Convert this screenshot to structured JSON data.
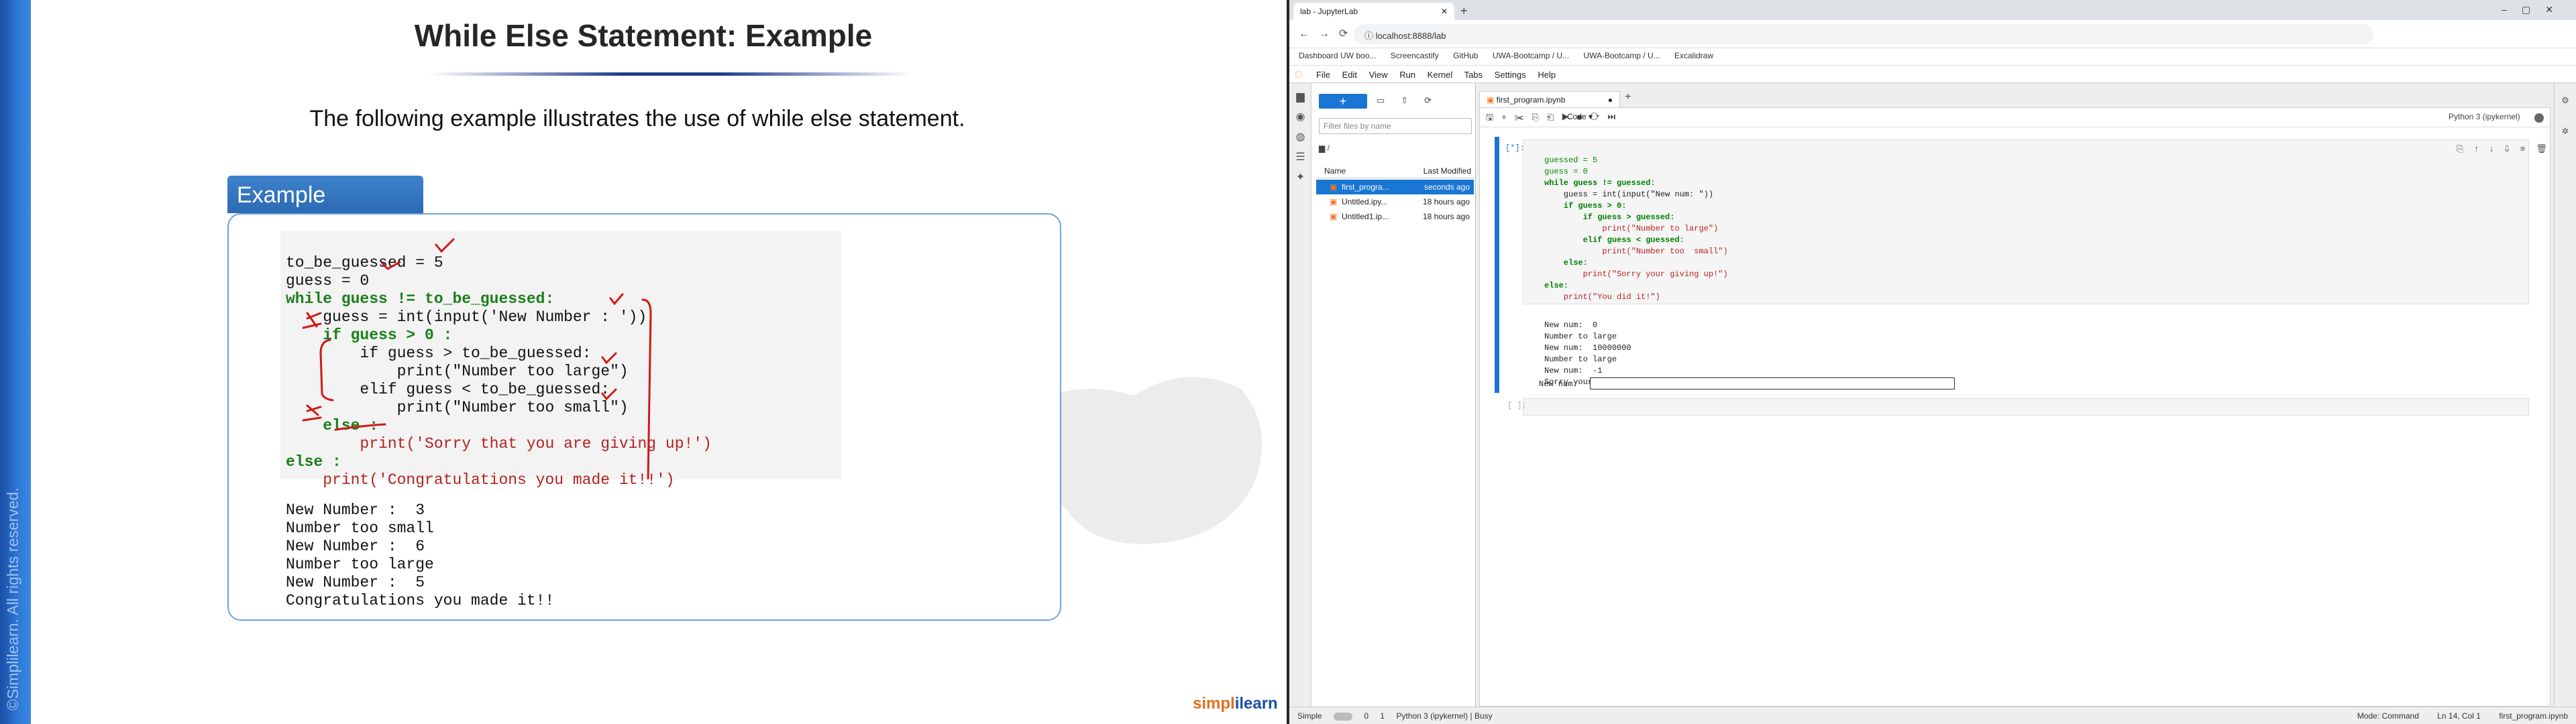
{
  "slide": {
    "title": "While Else Statement: Example",
    "subtitle": "The following example illustrates the use of while else statement.",
    "example_label": "Example",
    "copyright": "©Simplilearn. All rights reserved.",
    "logo_a": "simpl",
    "logo_b": "ilearn",
    "code_lines": [
      "to_be_guessed = 5",
      "guess = 0",
      "while guess != to_be_guessed:",
      "    guess = int(input('New Number : '))",
      "    if guess > 0 :",
      "        if guess > to_be_guessed:",
      "            print(\"Number too large\")",
      "        elif guess < to_be_guessed:",
      "            print(\"Number too small\")",
      "    else :",
      "        print('Sorry that you are giving up!')",
      "else :",
      "    print('Congratulations you made it!!')"
    ],
    "output_lines": [
      "New Number :  3",
      "Number too small",
      "New Number :  6",
      "Number too large",
      "New Number :  5",
      "Congratulations you made it!!"
    ]
  },
  "browser": {
    "tab_title": "lab - JupyterLab",
    "url": "localhost:8888/lab",
    "bookmarks": [
      "Dashboard UW boo...",
      "Screencastify",
      "GitHub",
      "UWA-Bootcamp / U...",
      "UWA-Bootcamp / U...",
      "Excalidraw"
    ],
    "menu": [
      "File",
      "Edit",
      "View",
      "Run",
      "Kernel",
      "Tabs",
      "Settings",
      "Help"
    ],
    "filter_placeholder": "Filter files by name",
    "breadcrumb": "/",
    "col_name": "Name",
    "col_modified": "Last Modified",
    "files": [
      {
        "name": "first_progra...",
        "modified": "seconds ago",
        "selected": true
      },
      {
        "name": "Untitled.ipy...",
        "modified": "18 hours ago",
        "selected": false
      },
      {
        "name": "Untitled1.ip...",
        "modified": "18 hours ago",
        "selected": false
      }
    ],
    "notebook_tab": "first_program.ipynb",
    "cell_type": "Code",
    "kernel": "Python 3 (ipykernel)",
    "cell1_prompt": "[*]:",
    "cell1_code": [
      "guessed = 5",
      "guess = 0",
      "while guess != guessed:",
      "    guess = int(input(\"New num: \"))",
      "    if guess > 0:",
      "        if guess > guessed:",
      "            print(\"Number to large\")",
      "        elif guess < guessed:",
      "            print(\"Number too  small\")",
      "    else:",
      "        print(\"Sorry your giving up!\")",
      "else:",
      "    print(\"You did it!\")"
    ],
    "cell1_output": [
      "New num:  0",
      "Number to large",
      "New num:  10000000",
      "Number to large",
      "New num:  -1",
      "Sorry your giving up!"
    ],
    "input_prompt": "New num:",
    "cell2_prompt": "[ ]:",
    "status": {
      "mode_label": "Simple",
      "counts": "0",
      "counts2": "1",
      "kernel_status": "Python 3 (ipykernel) | Busy",
      "mode": "Mode: Command",
      "position": "Ln 14, Col 1",
      "file": "first_program.ipynb"
    }
  }
}
